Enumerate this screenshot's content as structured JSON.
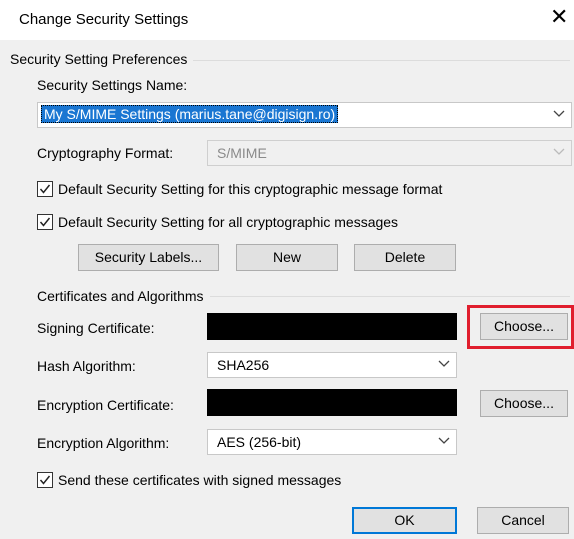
{
  "window": {
    "title": "Change Security Settings",
    "close_glyph": "✕"
  },
  "preferences": {
    "group_title": "Security Setting Preferences",
    "name_label": "Security Settings Name:",
    "name_value": "My S/MIME Settings (marius.tane@digisign.ro)",
    "format_label": "Cryptography Format:",
    "format_value": "S/MIME",
    "default_format_label": "Default Security Setting for this cryptographic message format",
    "default_format_checked": true,
    "default_all_label": "Default Security Setting for all cryptographic messages",
    "default_all_checked": true,
    "security_labels_button": "Security Labels...",
    "new_button": "New",
    "delete_button": "Delete"
  },
  "certificates": {
    "group_title": "Certificates and Algorithms",
    "signing_label": "Signing Certificate:",
    "signing_choose_button": "Choose...",
    "hash_label": "Hash Algorithm:",
    "hash_value": "SHA256",
    "encryption_label": "Encryption Certificate:",
    "encryption_choose_button": "Choose...",
    "enc_algo_label": "Encryption Algorithm:",
    "enc_algo_value": "AES (256-bit)",
    "send_certs_label": "Send these certificates with signed messages",
    "send_certs_checked": true
  },
  "footer": {
    "ok_button": "OK",
    "cancel_button": "Cancel"
  },
  "colors": {
    "selection": "#1a76d2",
    "highlight_box": "#e01e2d",
    "default_button_border": "#0078d7"
  },
  "icons": [
    "close-icon",
    "chevron-down-icon",
    "checkmark-icon"
  ]
}
